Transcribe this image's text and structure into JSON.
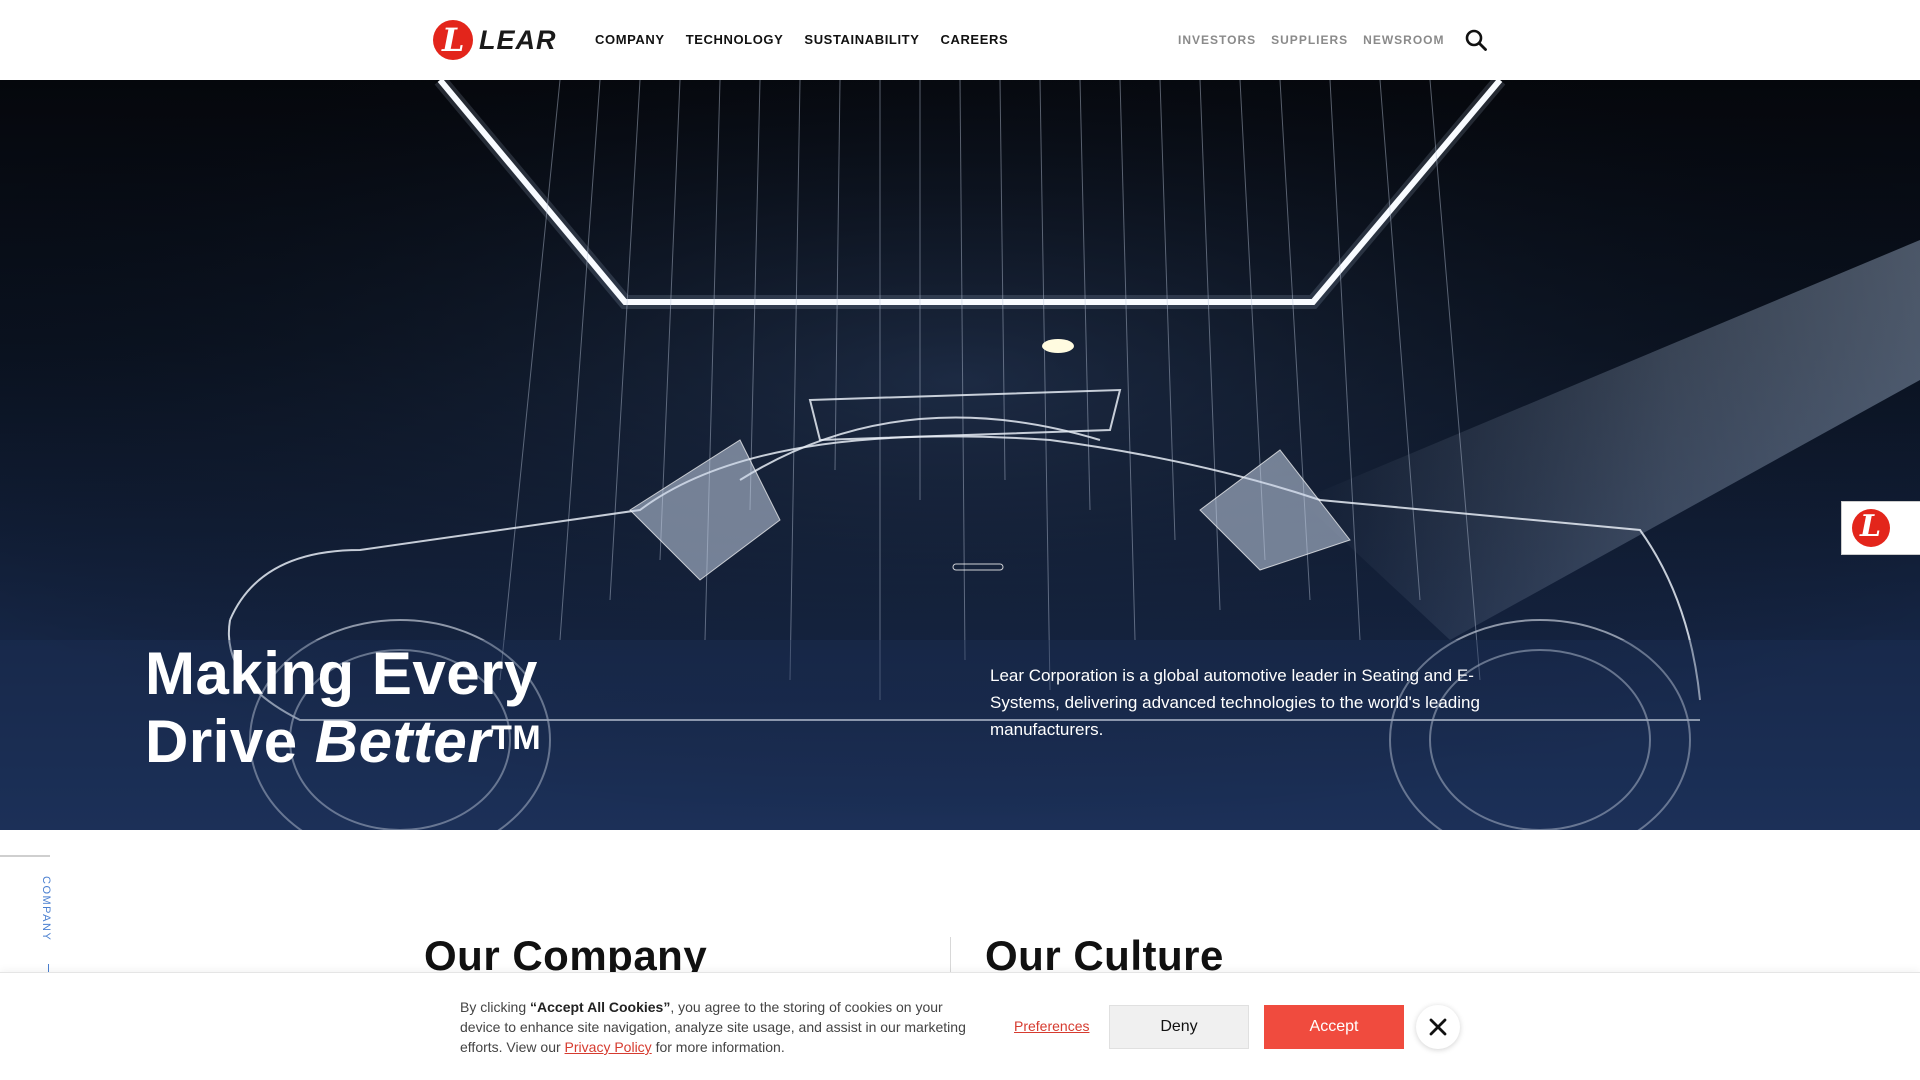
{
  "header": {
    "logo_text": "LEAR",
    "logo_mark": "L",
    "nav_main": [
      "COMPANY",
      "TECHNOLOGY",
      "SUSTAINABILITY",
      "CAREERS"
    ],
    "nav_util": [
      "INVESTORS",
      "SUPPLIERS",
      "NEWSROOM"
    ],
    "search_icon": "search-icon"
  },
  "hero": {
    "title_line1": "Making Every",
    "title_line2_plain": "Drive ",
    "title_line2_em": "Better",
    "title_tm": "TM",
    "description": "Lear Corporation is a global automotive leader in Seating and E-Systems, delivering advanced technologies to the world's leading manufacturers.",
    "side_badge_mark": "L"
  },
  "content": {
    "rail_label": "COMPANY",
    "heading_left": "Our Company",
    "heading_right": "Our Culture"
  },
  "cookie": {
    "text_prefix": "By clicking ",
    "text_bold": "“Accept All Cookies”",
    "text_middle": ", you agree to the storing of cookies on your device to enhance site navigation, analyze site usage, and assist in our marketing efforts. View our ",
    "privacy_link": "Privacy Policy",
    "text_suffix": " for more information.",
    "preferences": "Preferences",
    "deny": "Deny",
    "accept": "Accept",
    "close_icon": "close-icon"
  },
  "colors": {
    "brand_red": "#e3251b",
    "accept_red": "#f04b3e",
    "link_red": "#d63b2f",
    "hero_navy": "#1c3058",
    "rail_blue": "#4a7fd0"
  }
}
